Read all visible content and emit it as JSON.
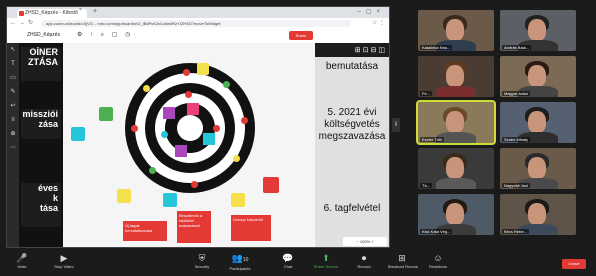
{
  "browser": {
    "tab_title": "ZHSD_Képzés - Kifestő",
    "tab_close": "×",
    "tab_new": "+",
    "window_controls": "–▢×",
    "nav_icons": "←→↻",
    "url": "app.zoom.us/board/uXjVO... miro.com/app/board/o9J_lBdPuK2d1o6w0RzY/ZHSD?moveToWidget",
    "addr_icons": "☆ ⋮"
  },
  "miro": {
    "board_name": "ZHSD_Képzés",
    "toolbar_icons": "⚙ ↑ ⌕ ▢ ◷",
    "share_label": "Share",
    "left_tools": [
      "↖",
      "T",
      "▭",
      "✎",
      "↩",
      "≡",
      "⊕",
      "⋯"
    ],
    "left_slides": [
      "OÍNER\nZTÁSA",
      "missziói\nzása",
      "éves\nk\ntása"
    ],
    "right_icons": "⊞⊡⊟◫",
    "right_slides": [
      "bemutatása",
      "5. 2021 évi\nköltségvetés\nmegszavazása",
      "6. tagfelvétel"
    ],
    "zoom_label": "−  100%  +",
    "red_notes": [
      "Új tagok bemutatkozása",
      "Beszámoló a kiküldött szavazásról",
      "Ünnepi köszöntő"
    ],
    "colors": {
      "red": "#e53935",
      "yellow": "#f4e04d",
      "green": "#4caf50",
      "cyan": "#26c6da",
      "purple": "#ab47bc",
      "pink": "#ec407a"
    }
  },
  "participants": [
    {
      "name": "Katalinka Kiss..."
    },
    {
      "name": "András Bala..."
    },
    {
      "name": "Fe..."
    },
    {
      "name": "Magyar Anikó"
    },
    {
      "name": "Eszter Tóth"
    },
    {
      "name": "Szabó Mihály"
    },
    {
      "name": "Tá..."
    },
    {
      "name": "Nagyváti Jani"
    },
    {
      "name": "Kiss Kata Vég..."
    },
    {
      "name": "Bécs Rebe..."
    }
  ],
  "controls": {
    "mute": {
      "icon": "🎤",
      "label": "Mute"
    },
    "video": {
      "icon": "▶",
      "label": "Stop Video"
    },
    "security": {
      "icon": "⛨",
      "label": "Security"
    },
    "participants": {
      "icon": "👥",
      "label": "Participants",
      "count": "10"
    },
    "chat": {
      "icon": "💬",
      "label": "Chat"
    },
    "share": {
      "icon": "⬆",
      "label": "Share Screen"
    },
    "record": {
      "icon": "⏺",
      "label": "Record"
    },
    "breakout": {
      "icon": "⊞",
      "label": "Breakout Rooms"
    },
    "reactions": {
      "icon": "☺",
      "label": "Reactions"
    },
    "end": "Leave"
  }
}
